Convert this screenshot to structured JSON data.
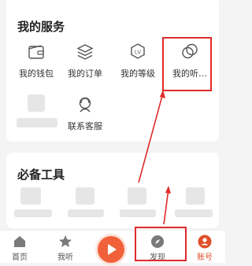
{
  "services": {
    "title": "我的服务",
    "items": [
      {
        "label": "我的钱包",
        "icon": "wallet-icon"
      },
      {
        "label": "我的订单",
        "icon": "layers-icon"
      },
      {
        "label": "我的等级",
        "icon": "level-badge-icon"
      },
      {
        "label": "我的听…",
        "icon": "circles-icon"
      },
      {
        "label": "",
        "icon": "blurred-item"
      },
      {
        "label": "联系客服",
        "icon": "customer-service-icon"
      }
    ]
  },
  "tools": {
    "title": "必备工具"
  },
  "bottom_nav": {
    "items": [
      {
        "label": "首页",
        "icon": "home-icon"
      },
      {
        "label": "我听",
        "icon": "star-icon"
      },
      {
        "label": "",
        "icon": "play-icon"
      },
      {
        "label": "发现",
        "icon": "compass-icon"
      },
      {
        "label": "账号",
        "icon": "account-icon"
      }
    ]
  },
  "colors": {
    "accent": "#f0613b",
    "highlight": "#e02b2b"
  }
}
